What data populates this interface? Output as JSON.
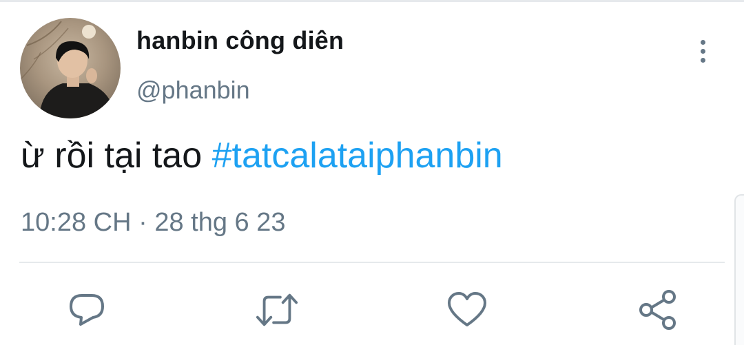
{
  "tweet": {
    "display_name": "hanbin công diên",
    "handle": "@phanbin",
    "text_plain": "ừ rồi tại tao ",
    "hashtag": "#tatcalataiphanbin",
    "time": "10:28 CH",
    "separator": "·",
    "date": "28 thg 6 23"
  },
  "icons": {
    "more": "more-vertical-icon",
    "reply": "reply-icon",
    "retweet": "retweet-icon",
    "like": "heart-icon",
    "share": "share-icon"
  },
  "colors": {
    "hashtag": "#1da1f2",
    "secondary_text": "#657786",
    "primary_text": "#14171a",
    "divider": "#e6e9ec"
  }
}
